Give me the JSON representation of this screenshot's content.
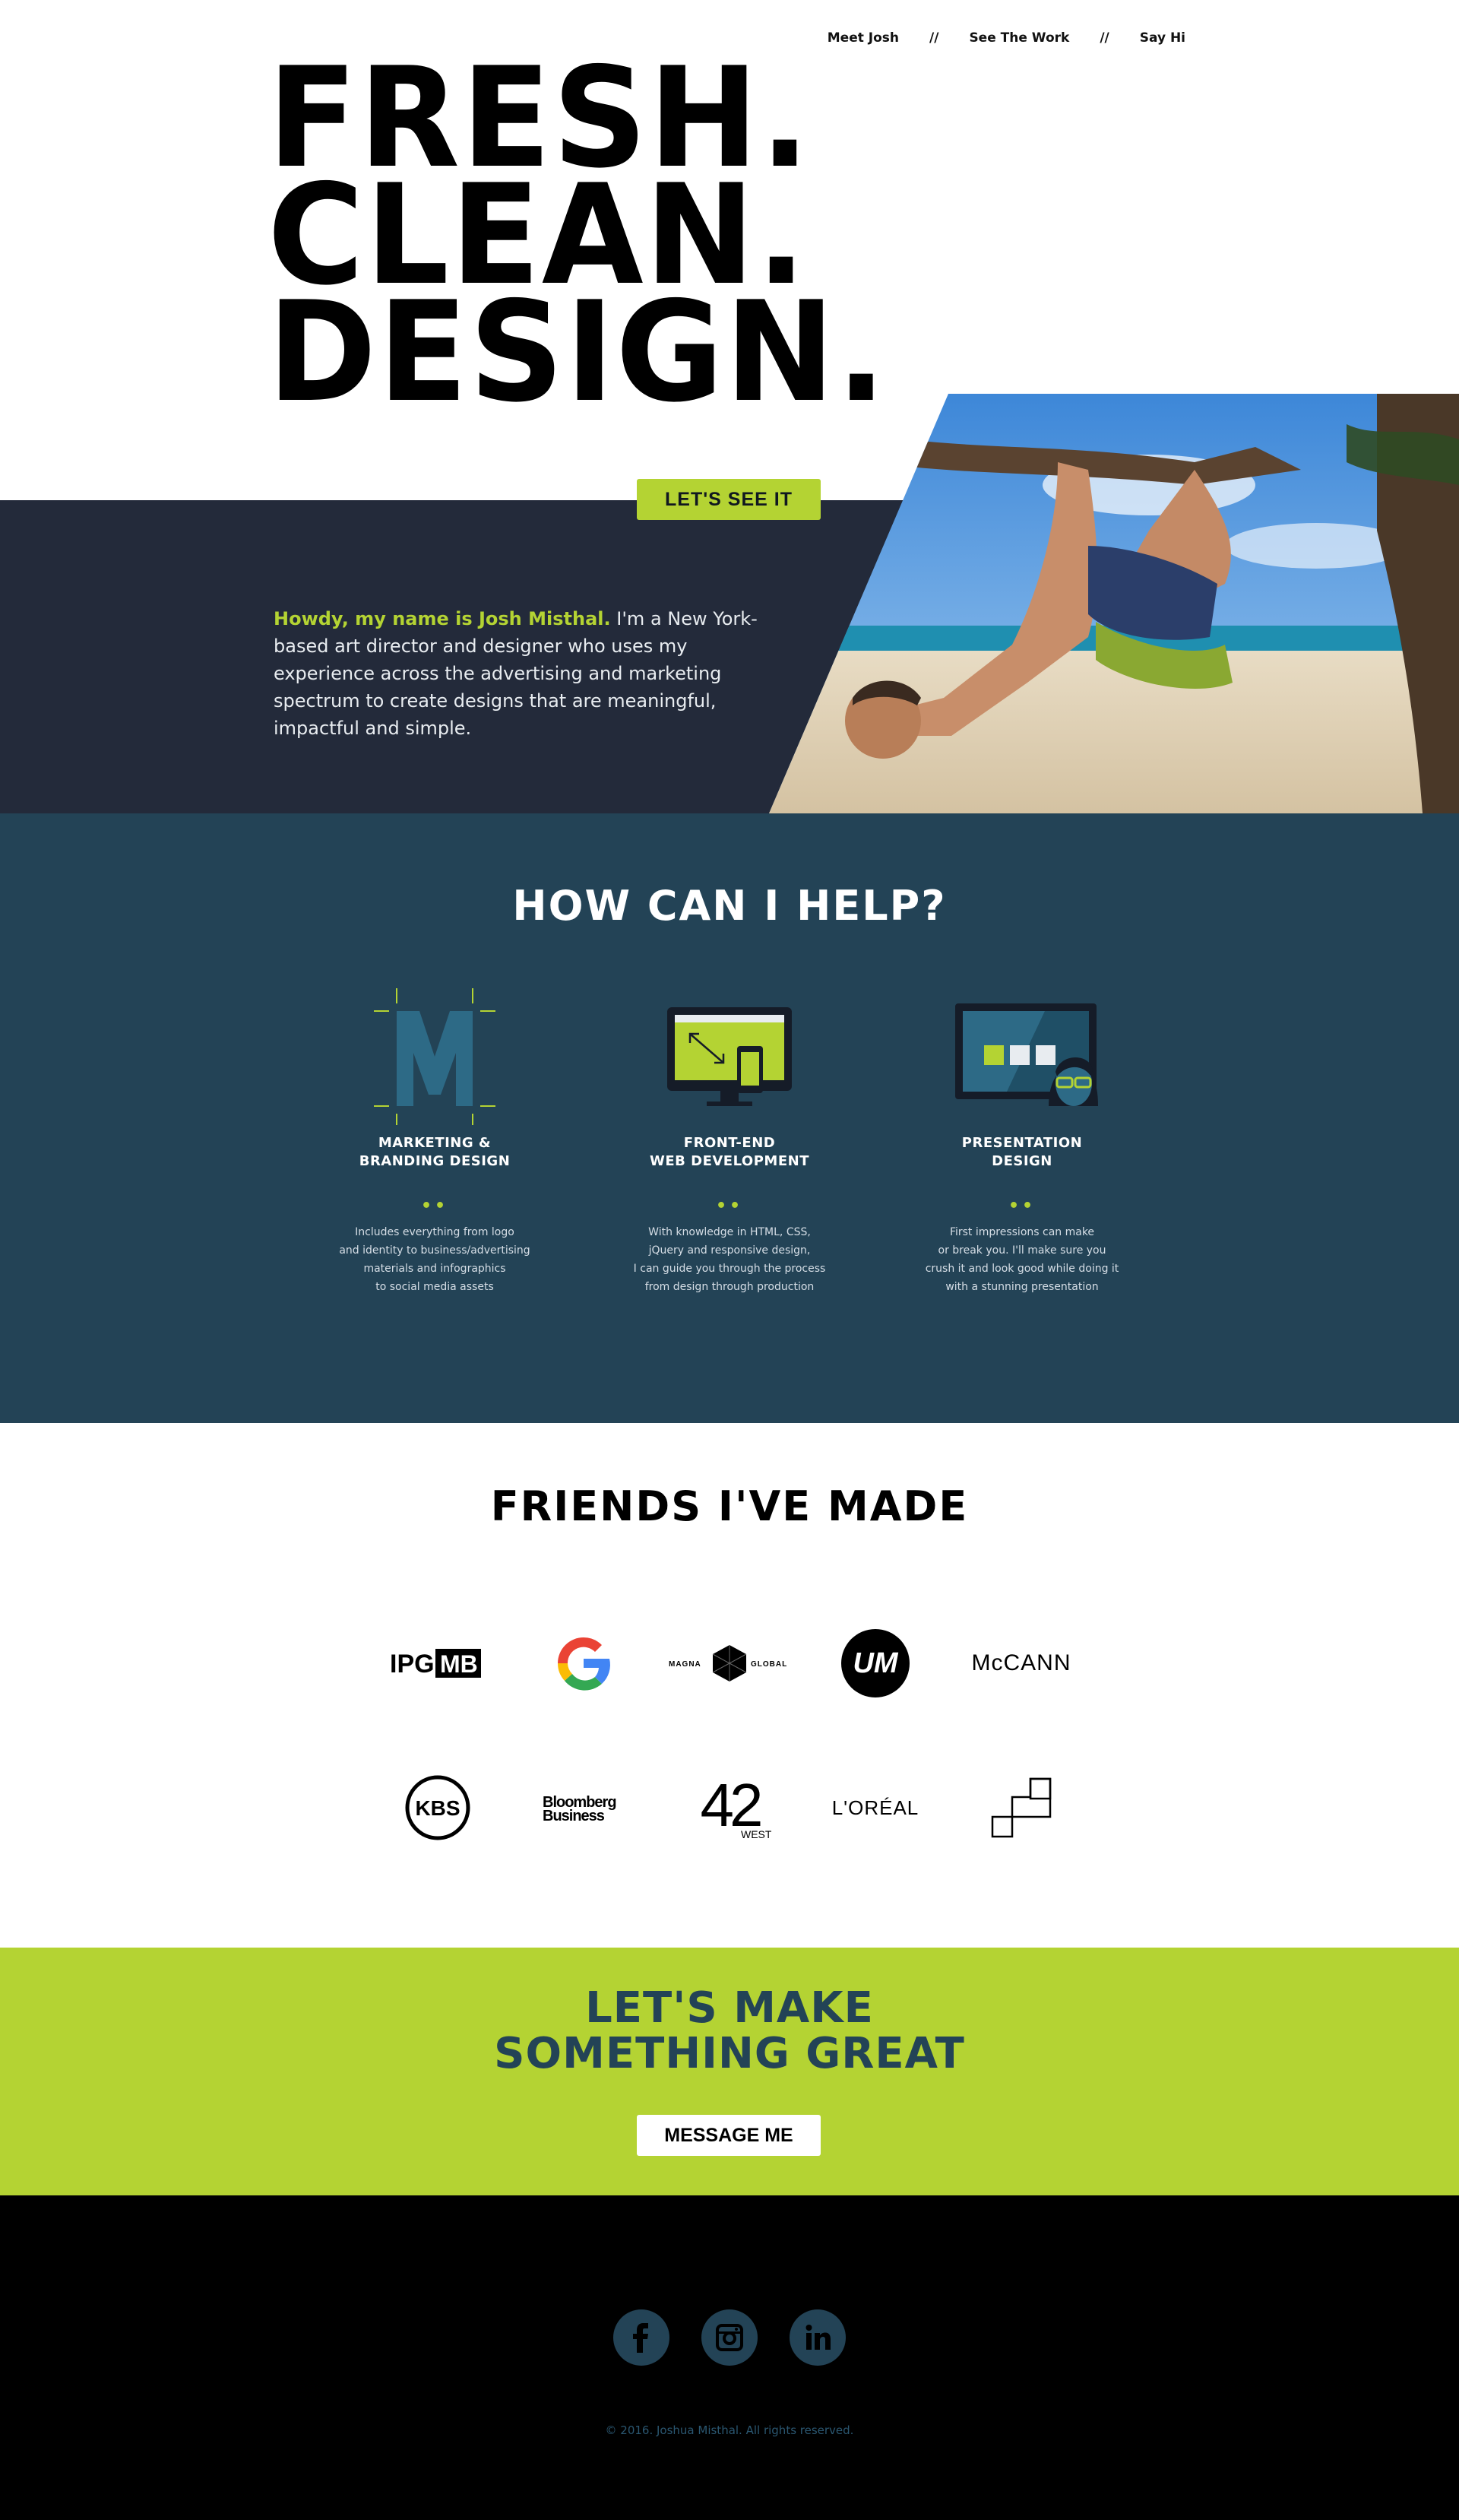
{
  "nav": {
    "items": [
      "Meet Josh",
      "See The Work",
      "Say Hi"
    ],
    "separator": "//"
  },
  "hero": {
    "lines": [
      "FRESH.",
      "CLEAN.",
      "DESIGN."
    ],
    "cta_label": "LET'S SEE IT",
    "intro_highlight": "Howdy, my name is Josh Misthal.",
    "intro_text": " I'm a New York-based art director and designer who uses my experience across the advertising and marketing spectrum to create designs that are meaningful, impactful and simple."
  },
  "help": {
    "title": "HOW CAN I HELP?",
    "services": [
      {
        "icon": "letter-m-icon",
        "name_lines": [
          "MARKETING &",
          "BRANDING DESIGN"
        ],
        "desc_lines": [
          "Includes everything from logo",
          "and identity to business/advertising",
          "materials and infographics",
          "to social media assets"
        ]
      },
      {
        "icon": "monitor-phone-icon",
        "name_lines": [
          "FRONT-END",
          "WEB DEVELOPMENT"
        ],
        "desc_lines": [
          "With knowledge in HTML, CSS,",
          "jQuery and responsive design,",
          "I can guide you through the process",
          "from design through production"
        ]
      },
      {
        "icon": "presentation-icon",
        "name_lines": [
          "PRESENTATION",
          "DESIGN"
        ],
        "desc_lines": [
          "First impressions can make",
          "or break you. I'll make sure you",
          "crush it and look good while doing it",
          "with a stunning presentation"
        ]
      }
    ],
    "dots": "••"
  },
  "friends": {
    "title": "FRIENDS I'VE MADE",
    "row1": [
      "IPG MB",
      "Google",
      "MAGNA GLOBAL",
      "UM",
      "McCANN"
    ],
    "row2": [
      "KBS",
      "Bloomberg Business",
      "42 WEST",
      "L'ORÉAL",
      "squares-logo"
    ]
  },
  "cta": {
    "title_lines": [
      "LET'S MAKE",
      "SOMETHING GREAT"
    ],
    "button_label": "MESSAGE ME"
  },
  "footer": {
    "social": [
      "facebook-icon",
      "instagram-icon",
      "linkedin-icon"
    ],
    "copyright": "© 2016. Joshua Misthal. All rights reserved."
  },
  "colors": {
    "accent": "#b4d333",
    "navy": "#232a3a",
    "teal": "#234356",
    "black": "#000000"
  }
}
